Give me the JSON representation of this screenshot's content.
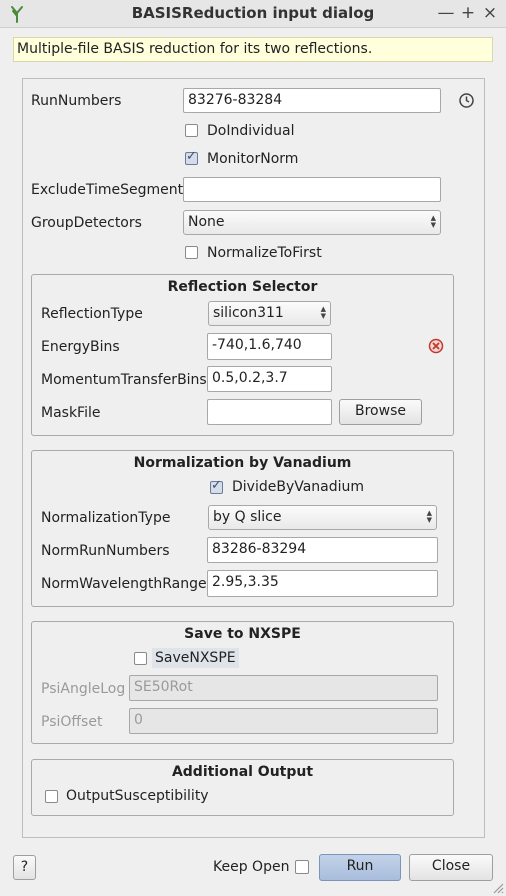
{
  "window": {
    "title": "BASISReduction input dialog",
    "minimize": "—",
    "maximize": "+",
    "close": "×"
  },
  "hint": "Multiple-file BASIS reduction for its two reflections.",
  "fields": {
    "run_numbers": {
      "label": "RunNumbers",
      "value": "83276-83284"
    },
    "do_individual": {
      "label": "DoIndividual",
      "checked": false
    },
    "monitor_norm": {
      "label": "MonitorNorm",
      "checked": true
    },
    "exclude_time_segment": {
      "label": "ExcludeTimeSegment",
      "value": ""
    },
    "group_detectors": {
      "label": "GroupDetectors",
      "value": "None"
    },
    "normalize_to_first": {
      "label": "NormalizeToFirst",
      "checked": false
    }
  },
  "reflection": {
    "title": "Reflection Selector",
    "reflection_type": {
      "label": "ReflectionType",
      "value": "silicon311"
    },
    "energy_bins": {
      "label": "EnergyBins",
      "value": "-740,1.6,740"
    },
    "momentum_bins": {
      "label": "MomentumTransferBins",
      "value": "0.5,0.2,3.7"
    },
    "mask_file": {
      "label": "MaskFile",
      "value": "",
      "browse": "Browse"
    }
  },
  "normalization": {
    "title": "Normalization by Vanadium",
    "divide_by_vanadium": {
      "label": "DivideByVanadium",
      "checked": true
    },
    "normalization_type": {
      "label": "NormalizationType",
      "value": "by Q slice"
    },
    "norm_run_numbers": {
      "label": "NormRunNumbers",
      "value": "83286-83294"
    },
    "norm_wavelength_range": {
      "label": "NormWavelengthRange",
      "value": "2.95,3.35"
    }
  },
  "nxspe": {
    "title": "Save to NXSPE",
    "save_nxspe": {
      "label": "SaveNXSPE",
      "checked": false
    },
    "psi_angle_log": {
      "label": "PsiAngleLog",
      "placeholder": "SE50Rot"
    },
    "psi_offset": {
      "label": "PsiOffset",
      "placeholder": "0"
    }
  },
  "additional": {
    "title": "Additional Output",
    "output_susceptibility": {
      "label": "OutputSusceptibility",
      "checked": false
    }
  },
  "footer": {
    "help": "?",
    "keep_open": "Keep Open",
    "run": "Run",
    "close": "Close"
  },
  "colors": {
    "hint_bg": "#ffffdc",
    "error_icon": "#c0392b",
    "run_button": "#a8bddc"
  }
}
